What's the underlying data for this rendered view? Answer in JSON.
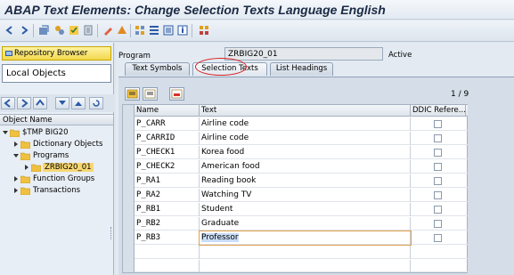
{
  "window": {
    "title": "ABAP Text Elements: Change Selection Texts Language English"
  },
  "toolbar": {
    "icons": [
      "back-icon",
      "forward-icon",
      "other-object-icon",
      "display-change-icon",
      "check-icon",
      "activate-icon",
      "edit-icon",
      "where-used-icon",
      "object-list-icon",
      "hierarchy-icon",
      "navigation-icon",
      "info-icon",
      "screen-icon",
      "transport-icon"
    ]
  },
  "navigator": {
    "repository_button": "Repository Browser",
    "object_type": "Local Objects",
    "column_header": "Object Name",
    "tree": [
      {
        "label": "$TMP BIG20",
        "level": 0,
        "expanded": true
      },
      {
        "label": "Dictionary Objects",
        "level": 1,
        "expanded": false
      },
      {
        "label": "Programs",
        "level": 1,
        "expanded": true
      },
      {
        "label": "ZRBIG20_01",
        "level": 2,
        "expanded": false,
        "selected": true
      },
      {
        "label": "Function Groups",
        "level": 1,
        "expanded": false
      },
      {
        "label": "Transactions",
        "level": 1,
        "expanded": false
      }
    ]
  },
  "editor": {
    "program_label": "Program",
    "program_name": "ZRBIG20_01",
    "status": "Active",
    "tabs": [
      {
        "label": "Text Symbols",
        "active": false
      },
      {
        "label": "Selection Texts",
        "active": true
      },
      {
        "label": "List Headings",
        "active": false
      }
    ],
    "page_indicator": "1 / 9",
    "columns": [
      "Name",
      "Text",
      "DDIC Refere..."
    ],
    "rows": [
      {
        "name": "P_CARR",
        "text": "Airline code",
        "ddic": false
      },
      {
        "name": "P_CARRID",
        "text": "Airline code",
        "ddic": false
      },
      {
        "name": "P_CHECK1",
        "text": "Korea food",
        "ddic": false
      },
      {
        "name": "P_CHECK2",
        "text": "American food",
        "ddic": false
      },
      {
        "name": "P_RA1",
        "text": "Reading book",
        "ddic": false
      },
      {
        "name": "P_RA2",
        "text": "Watching TV",
        "ddic": false
      },
      {
        "name": "P_RB1",
        "text": "Student",
        "ddic": false
      },
      {
        "name": "P_RB2",
        "text": "Graduate",
        "ddic": false
      },
      {
        "name": "P_RB3",
        "text": "Professor",
        "ddic": false
      }
    ]
  },
  "colors": {
    "accent_yellow": "#f2d850",
    "highlight_circle": "#d82020",
    "selection_blue": "#c9dcf7"
  }
}
